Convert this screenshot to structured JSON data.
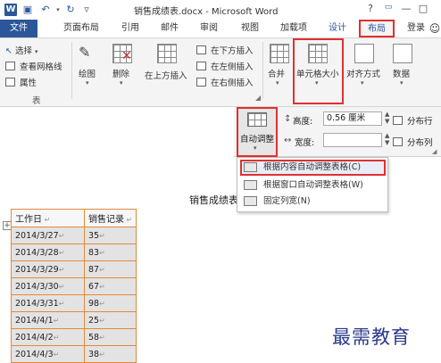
{
  "titlebar": {
    "title": "销售成绩表.docx - Microsoft Word",
    "word_logo": "W",
    "help": "?",
    "minimize": "—",
    "maximize": "□",
    "close": "✕",
    "table_tools_label": "表格工具"
  },
  "tabs": [
    {
      "label": "文件"
    },
    {
      "label": "页面布局"
    },
    {
      "label": "引用"
    },
    {
      "label": "邮件"
    },
    {
      "label": "审阅"
    },
    {
      "label": "视图"
    },
    {
      "label": "加载项"
    },
    {
      "label": "设计"
    },
    {
      "label": "布局"
    },
    {
      "label": "登录"
    }
  ],
  "ribbon": {
    "select": "选择",
    "view_gridlines": "查看网格线",
    "properties": "属性",
    "group_table": "表",
    "draw": "绘图",
    "delete": "删除",
    "insert_above": "在上方插入",
    "insert_below": "在下方插入",
    "insert_left": "在左侧插入",
    "insert_right": "在右侧插入",
    "merge": "合并",
    "cell_size": "单元格大小",
    "alignment": "对齐方式",
    "data": "数据"
  },
  "cellpanel": {
    "autofit": "自动调整",
    "height_label": "高度:",
    "height_value": "0.56 厘米",
    "width_label": "宽度:",
    "width_value": "",
    "distribute_rows": "分布行",
    "distribute_cols": "分布列"
  },
  "dropdown": {
    "items": [
      {
        "label": "根据内容自动调整表格(C)"
      },
      {
        "label": "根据窗口自动调整表格(W)"
      },
      {
        "label": "固定列宽(N)"
      }
    ]
  },
  "document": {
    "title": "销售成绩表",
    "table": {
      "headers": [
        "工作日",
        "销售记录"
      ],
      "rows": [
        [
          "2014/3/27",
          "35"
        ],
        [
          "2014/3/28",
          "83"
        ],
        [
          "2014/3/29",
          "87"
        ],
        [
          "2014/3/30",
          "67"
        ],
        [
          "2014/3/31",
          "98"
        ],
        [
          "2014/4/1",
          "25"
        ],
        [
          "2014/4/2",
          "58"
        ],
        [
          "2014/4/3",
          "38"
        ]
      ]
    }
  },
  "watermark": "最需教育",
  "colors": {
    "accent": "#2b579a",
    "highlight_red": "#e03030",
    "table_border": "#e08a3c"
  }
}
